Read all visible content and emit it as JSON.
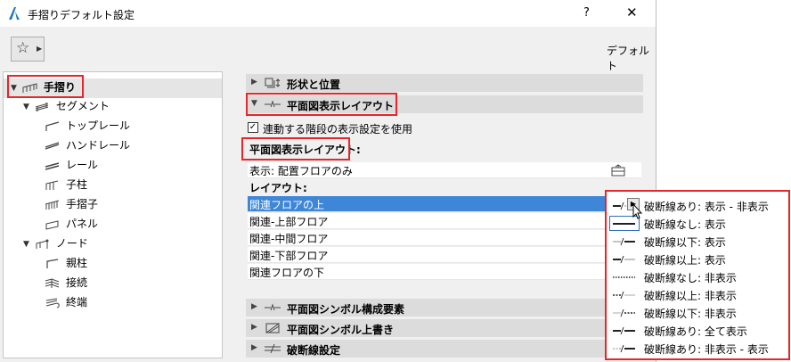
{
  "window": {
    "title": "手摺りデフォルト設定",
    "help": "?",
    "close": "✕"
  },
  "toolbar": {
    "default_label": "デフォルト"
  },
  "tree": {
    "root": "手摺り",
    "segment": "セグメント",
    "segment_items": [
      "トップレール",
      "ハンドレール",
      "レール",
      "子柱",
      "手摺子",
      "パネル"
    ],
    "node": "ノード",
    "node_items": [
      "親柱",
      "接続",
      "終端"
    ]
  },
  "sections": {
    "shape": "形状と位置",
    "plan_layout": "平面図表示レイアウト",
    "symbol_components": "平面図シンボル構成要素",
    "symbol_override": "平面図シンボル上書き",
    "break_line": "破断線設定"
  },
  "plan": {
    "checkbox_label": "連動する階段の表示設定を使用",
    "heading": "平面図表示レイアウト:",
    "display_label": "表示:",
    "display_value": "配置フロアのみ",
    "layout_label": "レイアウト:",
    "rows": [
      "関連フロアの上",
      "関連-上部フロア",
      "関連-中間フロア",
      "関連-下部フロア",
      "関連フロアの下"
    ]
  },
  "popup": {
    "items": [
      "破断線あり: 表示 - 非表示",
      "破断線なし: 表示",
      "破断線以下: 表示",
      "破断線以上: 表示",
      "破断線なし: 非表示",
      "破断線以上: 非表示",
      "破断線以下: 非表示",
      "破断線あり: 全て表示",
      "破断線あり: 非表示 - 表示"
    ]
  },
  "colors": {
    "accent_selection": "#3d86d8",
    "highlight_box": "#e5262a",
    "app_icon": "#1a73c8"
  }
}
